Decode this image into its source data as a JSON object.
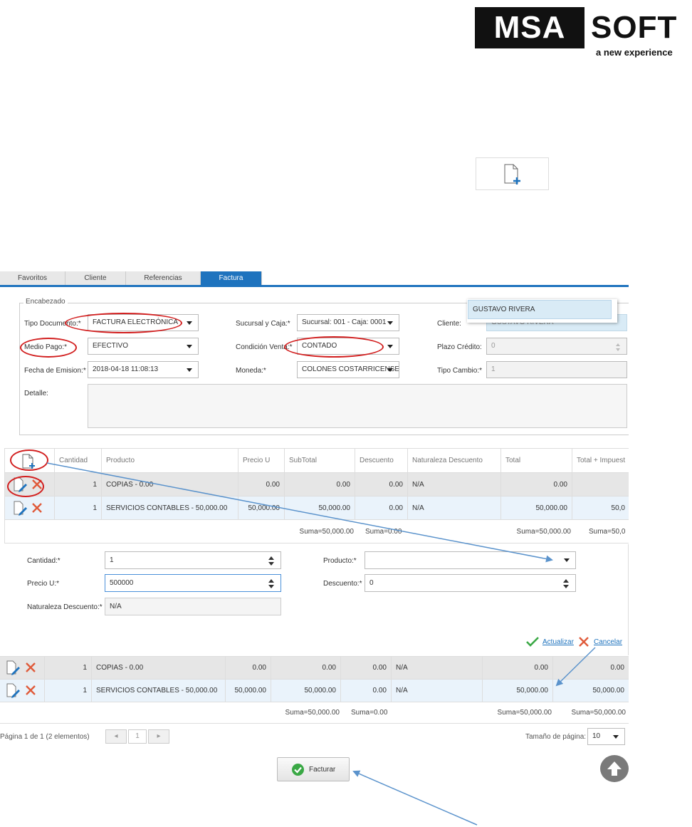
{
  "logo": {
    "left_text": "MSA",
    "right_text": "SOFT",
    "tagline": "a new experience"
  },
  "tabs": [
    "Favoritos",
    "Cliente",
    "Referencias",
    "Factura"
  ],
  "active_tab": "Factura",
  "header": {
    "legend": "Encabezado",
    "tipo_documento": {
      "label": "Tipo Documento:*",
      "value": "FACTURA ELECTRÓNICA"
    },
    "medio_pago": {
      "label": "Medio Pago:*",
      "value": "EFECTIVO"
    },
    "fecha_emision": {
      "label": "Fecha de Emision:*",
      "value": "2018-04-18 11:08:13"
    },
    "detalle": {
      "label": "Detalle:",
      "value": ""
    },
    "sucursal_caja": {
      "label": "Sucursal y Caja:*",
      "value": "Sucursal: 001 - Caja: 0001"
    },
    "condicion_venta": {
      "label": "Condición Venta:*",
      "value": "CONTADO"
    },
    "moneda": {
      "label": "Moneda:*",
      "value": "COLONES COSTARRICENSES"
    },
    "cliente": {
      "label": "Cliente:",
      "value": "GUSTAVO RIVERA"
    },
    "plazo_credito": {
      "label": "Plazo Crédito:",
      "value": "0"
    },
    "tipo_cambio": {
      "label": "Tipo Cambio:*",
      "value": "1"
    },
    "client_suggestion": "GUSTAVO RIVERA"
  },
  "grid1": {
    "columns": [
      "Cantidad",
      "Producto",
      "Precio U",
      "SubTotal",
      "Descuento",
      "Naturaleza Descuento",
      "Total",
      "Total + Impuest"
    ],
    "rows": [
      {
        "cantidad": "1",
        "producto": "COPIAS - 0.00",
        "precio": "0.00",
        "subtotal": "0.00",
        "descuento": "0.00",
        "naturaleza": "N/A",
        "total": "0.00",
        "total_imp": ""
      },
      {
        "cantidad": "1",
        "producto": "SERVICIOS CONTABLES - 50,000.00",
        "precio": "50,000.00",
        "subtotal": "50,000.00",
        "descuento": "0.00",
        "naturaleza": "N/A",
        "total": "50,000.00",
        "total_imp": "50,0"
      }
    ],
    "sums": {
      "subtotal": "Suma=50,000.00",
      "descuento": "Suma=0.00",
      "total": "Suma=50,000.00",
      "total_imp": "Suma=50,0"
    }
  },
  "edit_form": {
    "cantidad": {
      "label": "Cantidad:*",
      "value": "1"
    },
    "precio": {
      "label": "Precio U:*",
      "value": "500000"
    },
    "naturaleza": {
      "label": "Naturaleza Descuento:*",
      "value": "N/A"
    },
    "producto": {
      "label": "Producto:*",
      "value": ""
    },
    "descuento": {
      "label": "Descuento:*",
      "value": "0"
    },
    "actualizar": "Actualizar",
    "cancelar": "Cancelar"
  },
  "grid2": {
    "rows": [
      {
        "cantidad": "1",
        "producto": "COPIAS - 0.00",
        "precio": "0.00",
        "subtotal": "0.00",
        "descuento": "0.00",
        "naturaleza": "N/A",
        "total": "0.00",
        "total_imp": "0.00"
      },
      {
        "cantidad": "1",
        "producto": "SERVICIOS CONTABLES - 50,000.00",
        "precio": "50,000.00",
        "subtotal": "50,000.00",
        "descuento": "0.00",
        "naturaleza": "N/A",
        "total": "50,000.00",
        "total_imp": "50,000.00"
      }
    ],
    "sums": {
      "subtotal": "Suma=50,000.00",
      "descuento": "Suma=0.00",
      "total": "Suma=50,000.00",
      "total_imp": "Suma=50,000.00"
    }
  },
  "pager": {
    "info": "Página 1 de 1 (2 elementos)",
    "current_page": "1",
    "page_size_label": "Tamaño de página:",
    "page_size": "10"
  },
  "facturar_button": "Facturar",
  "icons": {
    "new_document": "document-add-icon",
    "edit": "edit-pencil-icon",
    "delete": "delete-x-icon",
    "check": "check-icon",
    "cancel": "cancel-x-icon",
    "scroll_top": "arrow-up-icon"
  },
  "colors": {
    "accent": "#1e73be",
    "annotation_red": "#d21f1f",
    "annotation_arrow": "#5b93cc",
    "delete_red": "#e05a3a",
    "check_green": "#3aa845"
  }
}
